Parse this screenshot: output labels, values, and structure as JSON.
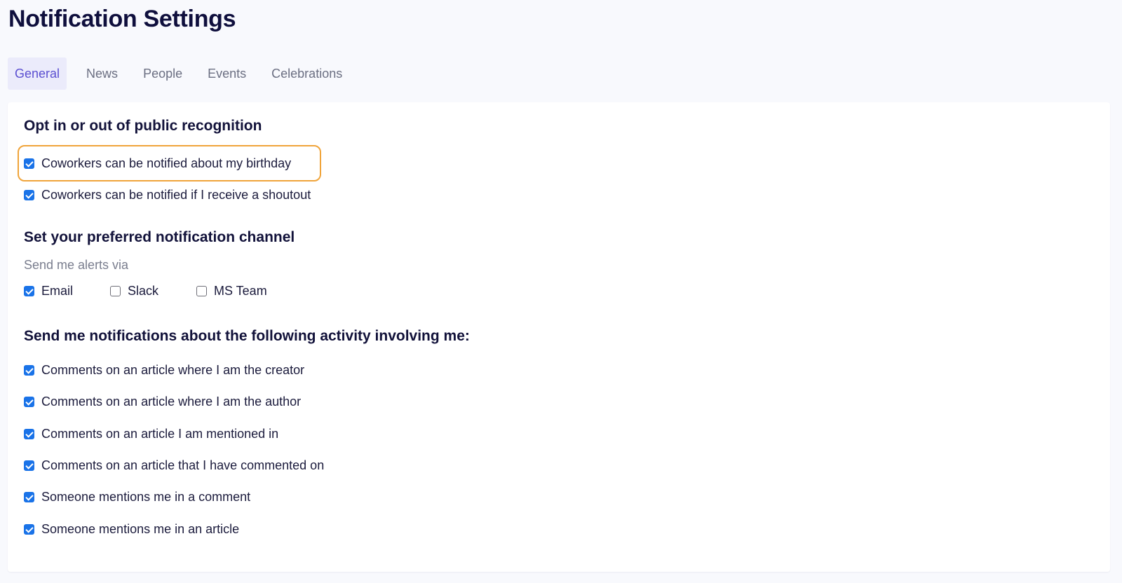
{
  "page": {
    "title": "Notification Settings"
  },
  "tabs": [
    {
      "label": "General",
      "active": true
    },
    {
      "label": "News",
      "active": false
    },
    {
      "label": "People",
      "active": false
    },
    {
      "label": "Events",
      "active": false
    },
    {
      "label": "Celebrations",
      "active": false
    }
  ],
  "recognition": {
    "title": "Opt in or out of public recognition",
    "options": [
      {
        "label": "Coworkers can be notified about my birthday",
        "checked": true
      },
      {
        "label": "Coworkers can be notified if I receive a shoutout",
        "checked": true
      }
    ]
  },
  "channel": {
    "title": "Set your preferred notification channel",
    "subtitle": "Send me alerts via",
    "options": [
      {
        "label": "Email",
        "checked": true
      },
      {
        "label": "Slack",
        "checked": false
      },
      {
        "label": "MS Team",
        "checked": false
      }
    ]
  },
  "activity": {
    "title": "Send me notifications about the following activity involving me:",
    "options": [
      {
        "label": "Comments on an article where I am the creator",
        "checked": true
      },
      {
        "label": "Comments on an article where I am the author",
        "checked": true
      },
      {
        "label": "Comments on an article I am mentioned in",
        "checked": true
      },
      {
        "label": "Comments on an article that I have commented on",
        "checked": true
      },
      {
        "label": "Someone mentions me in a comment",
        "checked": true
      },
      {
        "label": "Someone mentions me in an article",
        "checked": true
      }
    ]
  },
  "colors": {
    "accent": "#5b4fd1",
    "checkbox": "#1a73e8",
    "highlight": "#f0a43a"
  }
}
